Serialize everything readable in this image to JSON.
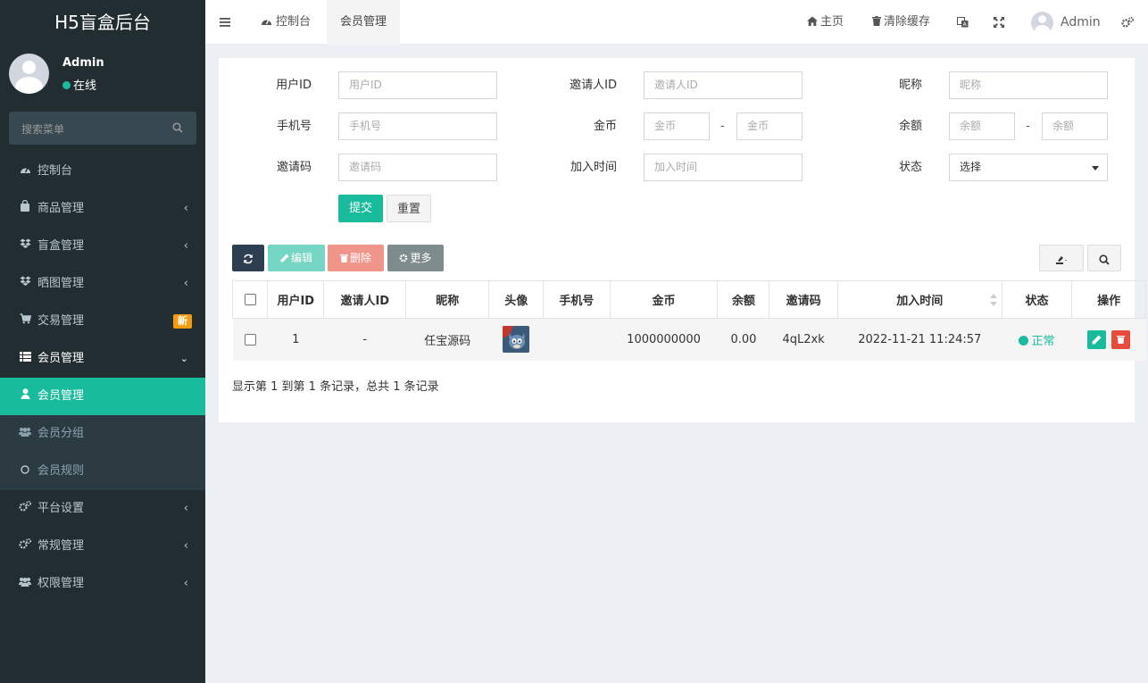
{
  "app": {
    "title": "H5盲盒后台"
  },
  "user": {
    "name": "Admin",
    "status": "在线"
  },
  "sidebar": {
    "search_placeholder": "搜索菜单",
    "items": [
      {
        "label": "控制台",
        "icon": "dashboard-icon"
      },
      {
        "label": "商品管理",
        "icon": "shopping-bag-icon"
      },
      {
        "label": "盲盒管理",
        "icon": "dropbox-icon"
      },
      {
        "label": "晒图管理",
        "icon": "dropbox-icon"
      },
      {
        "label": "交易管理",
        "icon": "cart-icon",
        "badge": "新"
      },
      {
        "label": "会员管理",
        "icon": "list-icon"
      },
      {
        "label": "会员管理",
        "icon": "user-icon"
      },
      {
        "label": "会员分组",
        "icon": "users-icon"
      },
      {
        "label": "会员规则",
        "icon": "circle-icon"
      },
      {
        "label": "平台设置",
        "icon": "gears-icon"
      },
      {
        "label": "常规管理",
        "icon": "gears-icon"
      },
      {
        "label": "权限管理",
        "icon": "users-icon"
      }
    ]
  },
  "header": {
    "tabs": [
      {
        "label": "控制台"
      },
      {
        "label": "会员管理"
      }
    ],
    "home": "主页",
    "clear_cache": "清除缓存",
    "admin": "Admin"
  },
  "filter": {
    "user_id": {
      "label": "用户ID",
      "placeholder": "用户ID"
    },
    "inviter_id": {
      "label": "邀请人ID",
      "placeholder": "邀请人ID"
    },
    "nickname": {
      "label": "昵称",
      "placeholder": "昵称"
    },
    "mobile": {
      "label": "手机号",
      "placeholder": "手机号"
    },
    "coins": {
      "label": "金币",
      "placeholder": "金币",
      "sep": "-"
    },
    "balance": {
      "label": "余额",
      "placeholder": "余额",
      "sep": "-"
    },
    "invite_code": {
      "label": "邀请码",
      "placeholder": "邀请码"
    },
    "join_time": {
      "label": "加入时间",
      "placeholder": "加入时间"
    },
    "status": {
      "label": "状态",
      "value": "选择"
    },
    "submit": "提交",
    "reset": "重置"
  },
  "toolbar": {
    "edit": "编辑",
    "delete": "删除",
    "more": "更多"
  },
  "table": {
    "headers": [
      "用户ID",
      "邀请人ID",
      "昵称",
      "头像",
      "手机号",
      "金币",
      "余额",
      "邀请码",
      "加入时间",
      "状态",
      "操作"
    ],
    "rows": [
      {
        "user_id": "1",
        "inviter_id": "-",
        "nickname": "任宝源码",
        "mobile": "",
        "coins": "1000000000",
        "balance": "0.00",
        "invite_code": "4qL2xk",
        "join_time": "2022-11-21 11:24:57",
        "status": "正常"
      }
    ],
    "summary": "显示第 1 到第 1 条记录，总共 1 条记录"
  },
  "colors": {
    "sidebar": "#222d32",
    "accent": "#18bc9c",
    "danger": "#e74c3c",
    "dark": "#2c3e50",
    "warning": "#f39c12"
  }
}
